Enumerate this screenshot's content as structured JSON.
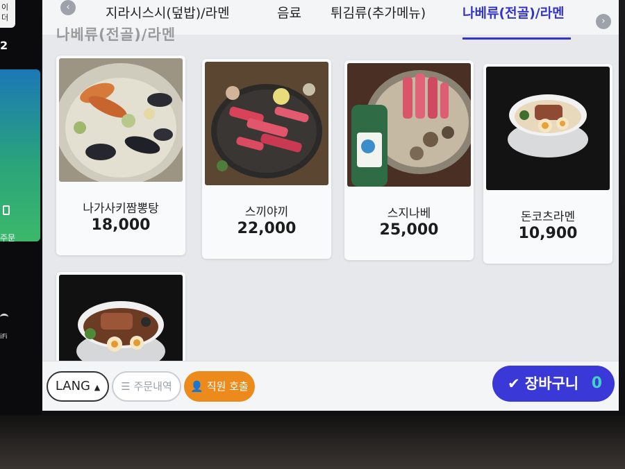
{
  "left_panel": {
    "top_text_line1": "이",
    "top_text_line2": "더",
    "number": "2",
    "order_label": "주문",
    "wifi_label": "iFi"
  },
  "tabs": [
    {
      "label": "지라시스시(덮밥)/라멘",
      "active": false
    },
    {
      "label": "음료",
      "active": false
    },
    {
      "label": "튀김류(추가메뉴)",
      "active": false
    },
    {
      "label": "나베류(전골)/라멘",
      "active": true
    }
  ],
  "nav": {
    "prev_icon": "chevron-left-icon",
    "next_icon": "chevron-right-icon",
    "prev_glyph": "‹",
    "next_glyph": "›"
  },
  "section_title": "나베류(전골)/라멘",
  "menu_items": [
    {
      "name": "나가사키짬뽕탕",
      "price": "18,000",
      "photo": "seafood-hotpot"
    },
    {
      "name": "스끼야끼",
      "price": "22,000",
      "photo": "beef-sukiyaki"
    },
    {
      "name": "스지나베",
      "price": "25,000",
      "photo": "suji-nabe"
    },
    {
      "name": "돈코츠라멘",
      "price": "10,900",
      "photo": "tonkotsu-ramen"
    },
    {
      "name": "",
      "price": "",
      "photo": "ramen"
    }
  ],
  "bottom_bar": {
    "lang_label": "LANG",
    "lang_arrow": "▲",
    "history_icon": "list-icon",
    "history_label": "주문내역",
    "call_icon": "person-icon",
    "call_label": "직원 호출",
    "cart_icon": "check-icon",
    "cart_label": "장바구니",
    "cart_count": "0"
  },
  "colors": {
    "accent": "#3334c8",
    "cart_button": "#3a39d8",
    "call_button": "#ec8a1c",
    "cart_count": "#3fd2c8"
  }
}
